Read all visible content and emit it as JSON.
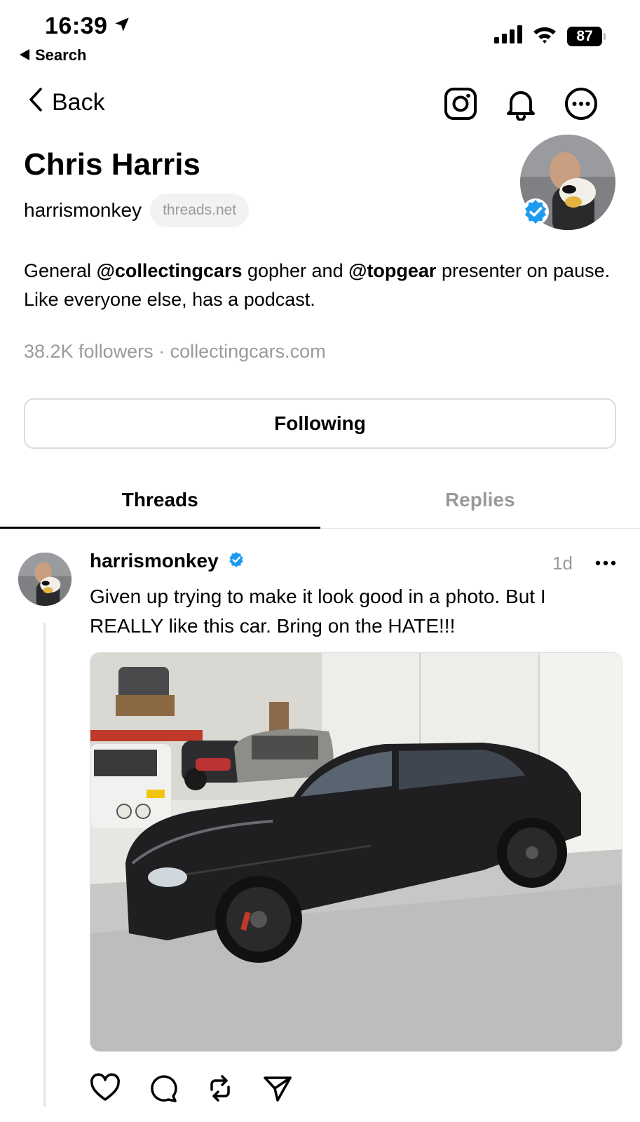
{
  "status_bar": {
    "time": "16:39",
    "back_app": "Search",
    "battery": "87"
  },
  "nav": {
    "back_label": "Back",
    "icons": [
      "instagram-icon",
      "bell-icon",
      "more-icon"
    ]
  },
  "profile": {
    "name": "Chris Harris",
    "handle": "harrismonkey",
    "domain": "threads.net",
    "bio_parts": [
      "General ",
      "@collectingcars",
      " gopher and ",
      "@topgear",
      " presenter on pause. Like everyone else, has a podcast."
    ],
    "followers": "38.2K followers",
    "separator": " · ",
    "website": "collectingcars.com",
    "follow_button": "Following"
  },
  "tabs": [
    {
      "label": "Threads",
      "active": true
    },
    {
      "label": "Replies",
      "active": false
    }
  ],
  "post": {
    "username": "harrismonkey",
    "time": "1d",
    "text": "Given up trying to make it look good in a photo.  But I REALLY like this car. Bring on the HATE!!!",
    "actions": [
      "heart-icon",
      "comment-icon",
      "repost-icon",
      "share-icon"
    ]
  },
  "colors": {
    "verified": "#1d9bf0",
    "muted": "#9a9a9a",
    "border": "#dbdbdb"
  }
}
